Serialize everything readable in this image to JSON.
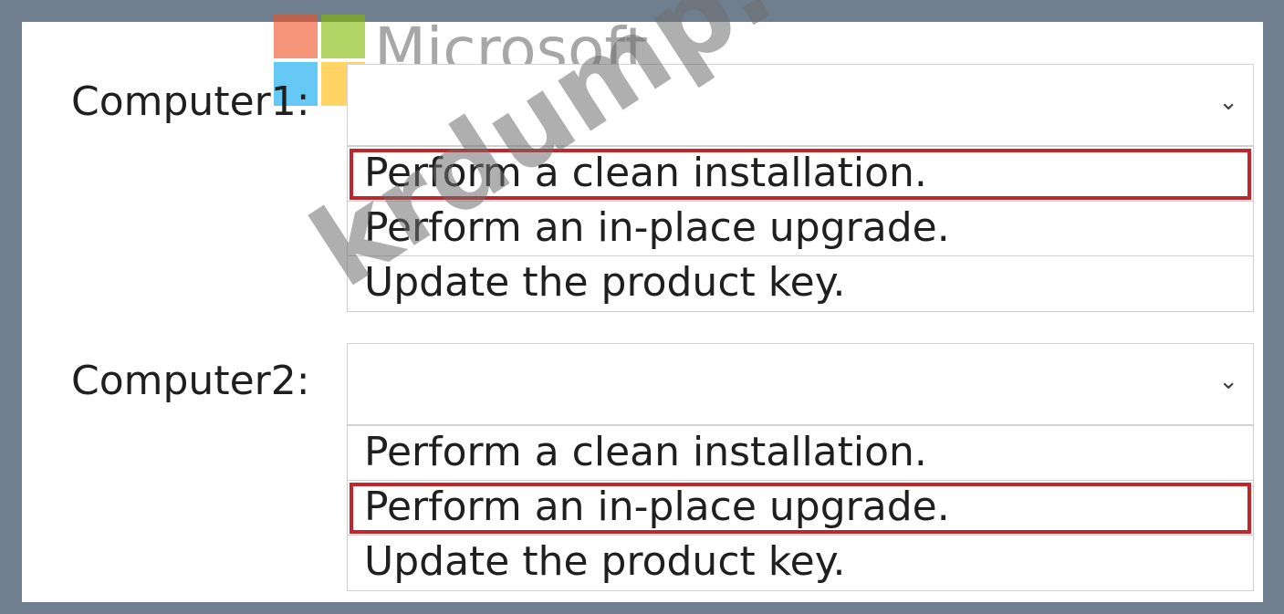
{
  "questions": [
    {
      "label": "Computer1:",
      "selected_value": "",
      "options": [
        {
          "label": "Perform a clean installation.",
          "selected": true
        },
        {
          "label": "Perform an in-place upgrade.",
          "selected": false
        },
        {
          "label": "Update the product key.",
          "selected": false
        }
      ]
    },
    {
      "label": "Computer2:",
      "selected_value": "",
      "options": [
        {
          "label": "Perform a clean installation.",
          "selected": false
        },
        {
          "label": "Perform an in-place upgrade.",
          "selected": true
        },
        {
          "label": "Update the product key.",
          "selected": false
        }
      ]
    }
  ],
  "branding": {
    "wordmark": "Microsoft",
    "logo_colors": [
      "#f25022",
      "#7fba00",
      "#00a4ef",
      "#ffb900"
    ]
  },
  "watermark": {
    "text": "krdump.com"
  },
  "colors": {
    "selection_outline": "#c3252c",
    "frame": "#6f7f8f"
  },
  "icons": {
    "dropdown": "chevron-down-icon"
  }
}
